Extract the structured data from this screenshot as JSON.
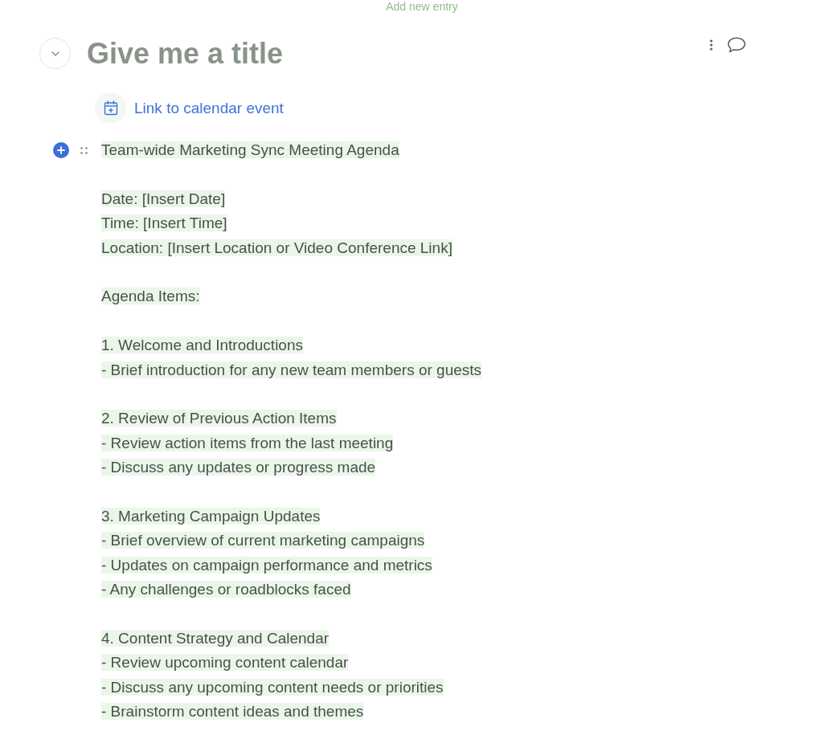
{
  "top_hint": "Add new entry",
  "document": {
    "title": "Give me a title"
  },
  "calendar_link": "Link to calendar event",
  "agenda": {
    "heading": "Team-wide Marketing Sync Meeting Agenda",
    "groups": [
      [
        "Date: [Insert Date]",
        "Time: [Insert Time]",
        "Location: [Insert Location or Video Conference Link]"
      ],
      [
        "Agenda Items:"
      ],
      [
        "1. Welcome and Introductions",
        "- Brief introduction for any new team members or guests"
      ],
      [
        "2. Review of Previous Action Items",
        "- Review action items from the last meeting",
        "- Discuss any updates or progress made"
      ],
      [
        "3. Marketing Campaign Updates",
        "- Brief overview of current marketing campaigns",
        "- Updates on campaign performance and metrics",
        "- Any challenges or roadblocks faced"
      ],
      [
        "4. Content Strategy and Calendar",
        "- Review upcoming content calendar",
        "- Discuss any upcoming content needs or priorities",
        "- Brainstorm content ideas and themes"
      ]
    ]
  }
}
